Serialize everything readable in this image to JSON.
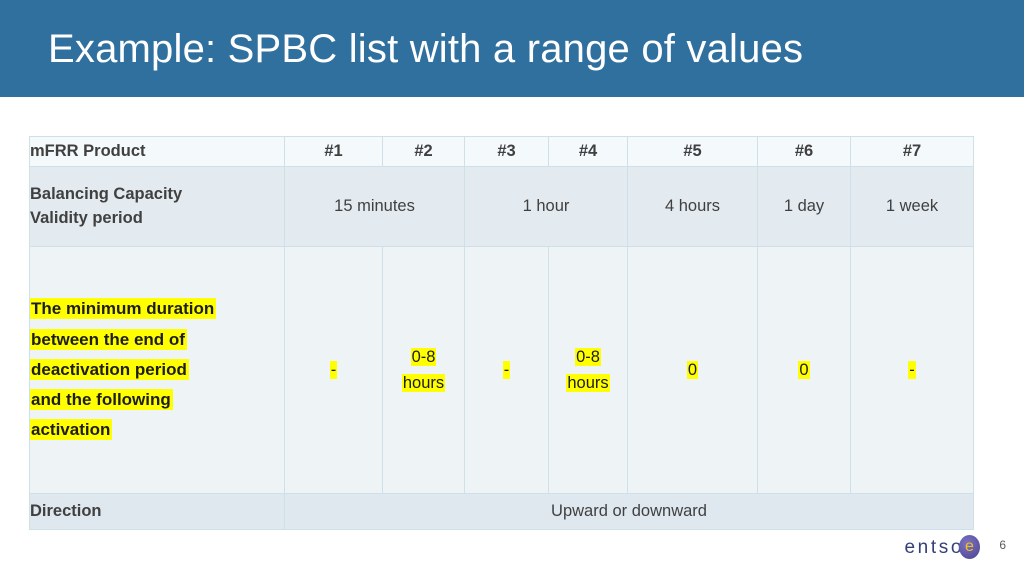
{
  "slide": {
    "title": "Example: SPBC list with a range of values",
    "page_number": "6",
    "accent_color": "#30709f",
    "highlight_color": "#ffff00"
  },
  "logo": {
    "text": "entso",
    "mark_letter": "e",
    "name": "entsoe-logo"
  },
  "table": {
    "header": {
      "label": "mFRR Product",
      "columns": [
        "#1",
        "#2",
        "#3",
        "#4",
        "#5",
        "#6",
        "#7"
      ]
    },
    "rows": [
      {
        "label": "Balancing Capacity Validity period",
        "label_lines": [
          "Balancing Capacity",
          "Validity period"
        ],
        "cells": [
          {
            "text": "15 minutes",
            "colspan": 2,
            "highlight": false
          },
          {
            "text": "1 hour",
            "colspan": 2,
            "highlight": false
          },
          {
            "text": "4 hours",
            "colspan": 1,
            "highlight": false
          },
          {
            "text": "1 day",
            "colspan": 1,
            "highlight": false
          },
          {
            "text": "1 week",
            "colspan": 1,
            "highlight": false
          }
        ]
      },
      {
        "label": "The minimum duration between the end of deactivation period and the following activation",
        "label_lines": [
          "The minimum duration",
          "between the end of",
          "deactivation period",
          "and the following",
          "activation"
        ],
        "label_highlight": true,
        "cells": [
          {
            "text": "-",
            "colspan": 1,
            "highlight": true
          },
          {
            "text": "0-8 hours",
            "lines": [
              "0-8",
              "hours"
            ],
            "colspan": 1,
            "highlight": true
          },
          {
            "text": "-",
            "colspan": 1,
            "highlight": true
          },
          {
            "text": "0-8 hours",
            "lines": [
              "0-8",
              "hours"
            ],
            "colspan": 1,
            "highlight": true
          },
          {
            "text": "0",
            "colspan": 1,
            "highlight": true
          },
          {
            "text": "0",
            "colspan": 1,
            "highlight": true
          },
          {
            "text": "-",
            "colspan": 1,
            "highlight": true
          }
        ]
      },
      {
        "label": "Direction",
        "label_lines": [
          "Direction"
        ],
        "cells": [
          {
            "text": "Upward or downward",
            "colspan": 7,
            "highlight": false
          }
        ]
      }
    ]
  }
}
